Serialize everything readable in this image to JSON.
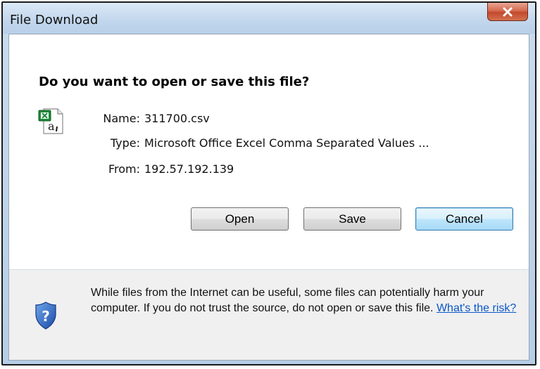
{
  "window": {
    "title": "File Download"
  },
  "dialog": {
    "question": "Do you want to open or save this file?",
    "fields": [
      {
        "label": "Name:",
        "value": "311700.csv"
      },
      {
        "label": "Type:",
        "value": "Microsoft Office Excel Comma Separated Values ..."
      },
      {
        "label": "From:",
        "value": "192.57.192.139"
      }
    ],
    "buttons": {
      "open": "Open",
      "save": "Save",
      "cancel": "Cancel"
    },
    "warning_text": "While files from the Internet can be useful, some files can potentially harm your computer. If you do not trust the source, do not open or save this file.",
    "risk_link": "What's the risk?"
  },
  "icons": {
    "close": "close-icon",
    "file": "excel-csv-file-icon",
    "security": "shield-question-icon"
  },
  "colors": {
    "title_bar": "#c3d7ed",
    "close_button": "#c24a2d",
    "default_button_border": "#3c7fb1",
    "link": "#0a56c9"
  }
}
